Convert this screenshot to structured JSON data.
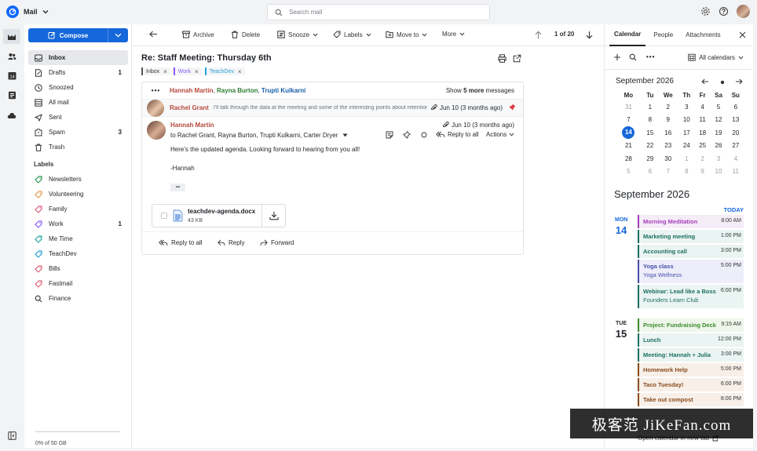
{
  "app": {
    "name": "Mail"
  },
  "search": {
    "placeholder": "Search mail"
  },
  "sidebar": {
    "compose_label": "Compose",
    "folders": [
      {
        "label": "Inbox",
        "count": "",
        "icon": "inbox-icon"
      },
      {
        "label": "Drafts",
        "count": "1",
        "icon": "drafts-icon"
      },
      {
        "label": "Snoozed",
        "count": "",
        "icon": "clock-icon"
      },
      {
        "label": "All mail",
        "count": "",
        "icon": "all-mail-icon"
      },
      {
        "label": "Sent",
        "count": "",
        "icon": "send-icon"
      },
      {
        "label": "Spam",
        "count": "3",
        "icon": "spam-icon"
      },
      {
        "label": "Trash",
        "count": "",
        "icon": "trash-icon"
      }
    ],
    "labels_heading": "Labels",
    "labels": [
      {
        "label": "Newsletters",
        "count": "",
        "color": "#2e9d5b"
      },
      {
        "label": "Volunteering",
        "count": "",
        "color": "#e0a04a"
      },
      {
        "label": "Family",
        "count": "",
        "color": "#e0627a"
      },
      {
        "label": "Work",
        "count": "1",
        "color": "#8b5cf6"
      },
      {
        "label": "Me Time",
        "count": "",
        "color": "#2aa7a0"
      },
      {
        "label": "TeachDev",
        "count": "",
        "color": "#2a9fd6"
      },
      {
        "label": "Bills",
        "count": "",
        "color": "#e0627a"
      },
      {
        "label": "Fastmail",
        "count": "",
        "color": "#e0627a"
      },
      {
        "label": "Finance",
        "count": "",
        "color": "#555555"
      }
    ],
    "storage": "0% of 50 GB"
  },
  "toolbar": {
    "archive": "Archive",
    "delete": "Delete",
    "snooze": "Snooze",
    "labels": "Labels",
    "move_to": "Move to",
    "more": "More",
    "position": "1 of 20"
  },
  "message": {
    "subject": "Re: Staff Meeting: Thursday 6th",
    "tags": [
      {
        "label": "Inbox",
        "color": "#555555"
      },
      {
        "label": "Work",
        "color": "#8b5cf6"
      },
      {
        "label": "TeachDev",
        "color": "#2a9fd6"
      }
    ],
    "collapsed_participants": [
      "Hannah Martin",
      "Rayna Burton",
      "Trupti Kulkarni"
    ],
    "participant_colors": [
      "#b5483b",
      "#2e7d32",
      "#1a5fa8"
    ],
    "show_more_prefix": "Show",
    "show_more_count": "5 more",
    "show_more_suffix": "messages",
    "prev": {
      "sender": "Rachel Grant",
      "snippet": "I'll talk through the data at the meeting and some of the interesting points about retention rates and engagement…",
      "date": "Jun 10 (3 months ago)"
    },
    "current": {
      "sender": "Hannah Martin",
      "to": "to Rachel Grant, Rayna Burton, Trupti Kulkarni, Carter Dryer",
      "date": "Jun 10 (3 months ago)",
      "reply_all": "Reply to all",
      "actions": "Actions",
      "body_line1": "Here's the updated agenda. Looking forward to hearing from you all!",
      "body_line2": "-Hannah",
      "ellipsis": "•••",
      "attachment": {
        "name": "teachdev-agenda.docx",
        "size": "43 KB"
      }
    },
    "footer": {
      "reply_all": "Reply to all",
      "reply": "Reply",
      "forward": "Forward"
    }
  },
  "calendar": {
    "tabs": [
      "Calendar",
      "People",
      "Attachments"
    ],
    "all_calendars": "All calendars",
    "month_title": "September 2026",
    "weekdays": [
      "Mo",
      "Tu",
      "We",
      "Th",
      "Fr",
      "Sa",
      "Su"
    ],
    "weeks": [
      [
        "31",
        "1",
        "2",
        "3",
        "4",
        "5",
        "6"
      ],
      [
        "7",
        "8",
        "9",
        "10",
        "11",
        "12",
        "13"
      ],
      [
        "14",
        "15",
        "16",
        "17",
        "18",
        "19",
        "20"
      ],
      [
        "21",
        "22",
        "23",
        "24",
        "25",
        "26",
        "27"
      ],
      [
        "28",
        "29",
        "30",
        "1",
        "2",
        "3",
        "4"
      ],
      [
        "5",
        "6",
        "7",
        "8",
        "9",
        "10",
        "11"
      ]
    ],
    "today_day": "14",
    "agenda_title": "September 2026",
    "today_label": "TODAY",
    "days": [
      {
        "dow": "MON",
        "num": "14",
        "events": [
          {
            "title": "Morning Meditation",
            "time": "8:00 AM",
            "color": "#a23fb8",
            "bg": "#f6ecf8",
            "sub": ""
          },
          {
            "title": "Marketing meeting",
            "time": "1:00 PM",
            "color": "#1d6f62",
            "bg": "#eaf4f2",
            "sub": ""
          },
          {
            "title": "Accounting call",
            "time": "3:00 PM",
            "color": "#1d6f62",
            "bg": "#eaf4f2",
            "sub": ""
          },
          {
            "title": "Yoga class",
            "time": "5:00 PM",
            "color": "#4a4fa8",
            "bg": "#edeefa",
            "sub": "Yoga Wellness"
          },
          {
            "title": "Webinar: Lead like a Boss",
            "time": "6:00 PM",
            "color": "#1d6f62",
            "bg": "#eaf4f2",
            "sub": "Founders Learn Club"
          }
        ]
      },
      {
        "dow": "TUE",
        "num": "15",
        "events": [
          {
            "title": "Project: Fundraising Deck",
            "time": "9:15 AM",
            "color": "#3c8a2e",
            "bg": "#eef6ea",
            "sub": ""
          },
          {
            "title": "Lunch",
            "time": "12:00 PM",
            "color": "#1d6f62",
            "bg": "#eaf4f2",
            "sub": ""
          },
          {
            "title": "Meeting: Hannah + Julia",
            "time": "3:00 PM",
            "color": "#1d6f62",
            "bg": "#eaf4f2",
            "sub": ""
          },
          {
            "title": "Homework Help",
            "time": "5:00 PM",
            "color": "#8a4b1c",
            "bg": "#f7efe8",
            "sub": ""
          },
          {
            "title": "Taco Tuesday!",
            "time": "6:00 PM",
            "color": "#8a4b1c",
            "bg": "#f7efe8",
            "sub": ""
          },
          {
            "title": "Take out compost",
            "time": "8:00 PM",
            "color": "#8a4b1c",
            "bg": "#f7efe8",
            "sub": ""
          }
        ]
      }
    ],
    "open_new_tab": "Open calendar in new tab"
  },
  "watermark": "极客范 JiKeFan.com"
}
